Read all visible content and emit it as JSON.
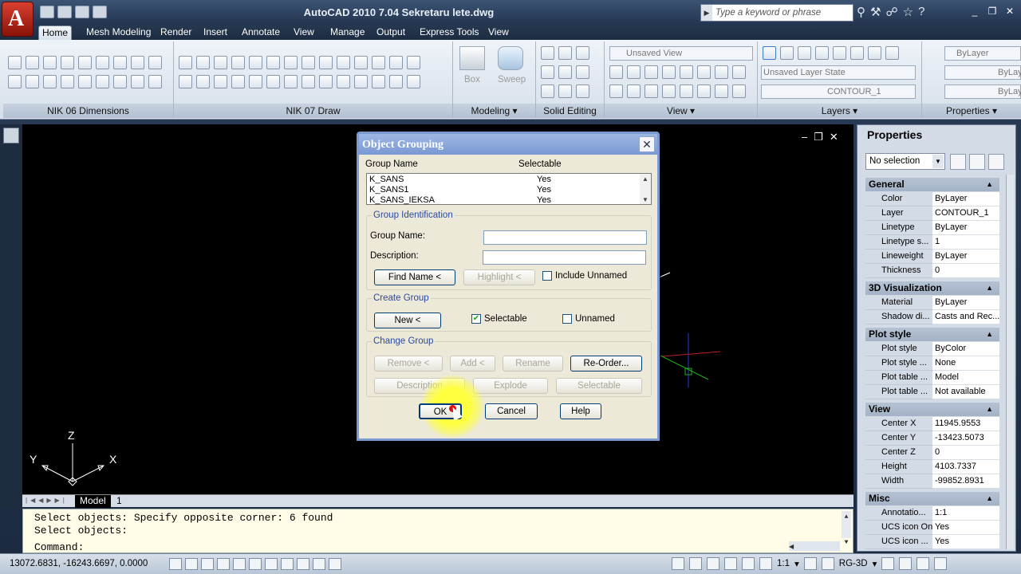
{
  "titlebar": {
    "title": "AutoCAD 2010     7.04 Sekretaru lete.dwg",
    "search_placeholder": "Type a keyword or phrase"
  },
  "ribbon_tabs": [
    "Home",
    "Mesh Modeling",
    "Render",
    "Insert",
    "Annotate",
    "View",
    "Manage",
    "Output",
    "Express Tools",
    "View"
  ],
  "ribbon": {
    "panels": [
      "NIK 06 Dimensions",
      "NIK 07 Draw",
      "Modeling",
      "Solid Editing",
      "View",
      "Layers",
      "Properties"
    ],
    "modeling_box": "Box",
    "modeling_sweep": "Sweep",
    "view_state": "Unsaved View",
    "layer_state": "Unsaved Layer State",
    "layer_current": "CONTOUR_1",
    "prop_bylayer": "ByLayer",
    "prop_bylayer2": "ByLay",
    "prop_bylayer3": "ByLay"
  },
  "layout_tabs": [
    "Model",
    "1"
  ],
  "command_line": {
    "line1": "Select objects: Specify opposite corner: 6 found",
    "line2": "Select objects:",
    "prompt": "Command:"
  },
  "statusbar": {
    "coords": "13072.6831, -16243.6697, 0.0000",
    "scale": "1:1",
    "workspace": "RG-3D"
  },
  "ucs": {
    "z": "Z",
    "y": "Y",
    "x": "X"
  },
  "properties": {
    "title": "Properties",
    "selection": "No selection",
    "sections": {
      "general": {
        "title": "General",
        "rows": [
          [
            "Color",
            "ByLayer"
          ],
          [
            "Layer",
            "CONTOUR_1"
          ],
          [
            "Linetype",
            "ByLayer"
          ],
          [
            "Linetype s...",
            "1"
          ],
          [
            "Lineweight",
            "ByLayer"
          ],
          [
            "Thickness",
            "0"
          ]
        ]
      },
      "viz": {
        "title": "3D Visualization",
        "rows": [
          [
            "Material",
            "ByLayer"
          ],
          [
            "Shadow di...",
            "Casts and Rec..."
          ]
        ]
      },
      "plot": {
        "title": "Plot style",
        "rows": [
          [
            "Plot style",
            "ByColor"
          ],
          [
            "Plot style ...",
            "None"
          ],
          [
            "Plot table ...",
            "Model"
          ],
          [
            "Plot table ...",
            "Not available"
          ]
        ]
      },
      "view": {
        "title": "View",
        "rows": [
          [
            "Center X",
            "11945.9553"
          ],
          [
            "Center Y",
            "-13423.5073"
          ],
          [
            "Center Z",
            "0"
          ],
          [
            "Height",
            "4103.7337"
          ],
          [
            "Width",
            "-99852.8931"
          ]
        ]
      },
      "misc": {
        "title": "Misc",
        "rows": [
          [
            "Annotatio...",
            "1:1"
          ],
          [
            "UCS icon On",
            "Yes"
          ],
          [
            "UCS icon ...",
            "Yes"
          ]
        ]
      }
    }
  },
  "dialog": {
    "title": "Object Grouping",
    "col_name": "Group Name",
    "col_selectable": "Selectable",
    "groups": [
      [
        "K_SANS",
        "Yes"
      ],
      [
        "K_SANS1",
        "Yes"
      ],
      [
        "K_SANS_IEKSA",
        "Yes"
      ]
    ],
    "identification": "Group Identification",
    "group_name_label": "Group Name:",
    "description_label": "Description:",
    "group_name_value": "",
    "description_value": "",
    "find_name": "Find Name <",
    "highlight": "Highlight <",
    "include_unnamed": "Include Unnamed",
    "include_unnamed_checked": false,
    "create_group": "Create Group",
    "new": "New <",
    "selectable": "Selectable",
    "selectable_checked": true,
    "unnamed": "Unnamed",
    "unnamed_checked": false,
    "change_group": "Change Group",
    "remove": "Remove <",
    "add": "Add <",
    "rename": "Rename",
    "reorder": "Re-Order...",
    "description_btn": "Description",
    "explode": "Explode",
    "selectable_btn": "Selectable",
    "ok": "OK",
    "cancel": "Cancel",
    "help": "Help"
  }
}
